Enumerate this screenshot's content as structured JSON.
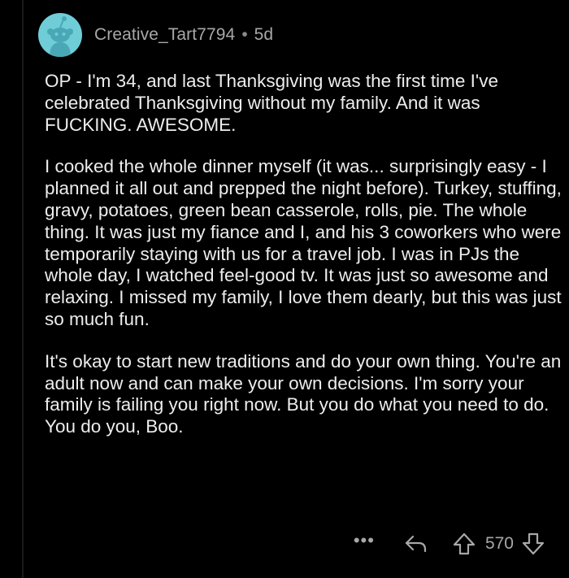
{
  "comment": {
    "author": "Creative_Tart7794",
    "separator": "•",
    "age": "5d",
    "paragraphs": [
      "OP - I'm 34, and last Thanksgiving was the first time I've celebrated Thanksgiving without my family. And it was FUCKING. AWESOME.",
      "I cooked the whole dinner myself (it was... surprisingly easy - I planned it all out and prepped the night before). Turkey, stuffing, gravy, potatoes, green bean casserole, rolls, pie. The whole thing. It was just my fiance and I, and his 3 coworkers who were temporarily staying with us for a travel job. I was in PJs the whole day, I watched feel-good tv. It was just so awesome and relaxing. I missed my family, I love them dearly, but this was just so much fun.",
      "It's okay to start new traditions and do your own thing. You're an adult now and can make your own decisions. I'm sorry your family is failing you right now. But you do what you need to do. You do you, Boo."
    ],
    "actions": {
      "more_label": "•••",
      "score": "570"
    }
  },
  "colors": {
    "background": "#000000",
    "avatar": "#6fcdd8",
    "text": "#ededed",
    "meta": "#a8a8a8"
  },
  "icons": {
    "avatar": "reddit-snoo-avatar-icon",
    "reply": "reply-arrow-icon",
    "upvote": "upvote-arrow-icon",
    "downvote": "downvote-arrow-icon"
  }
}
